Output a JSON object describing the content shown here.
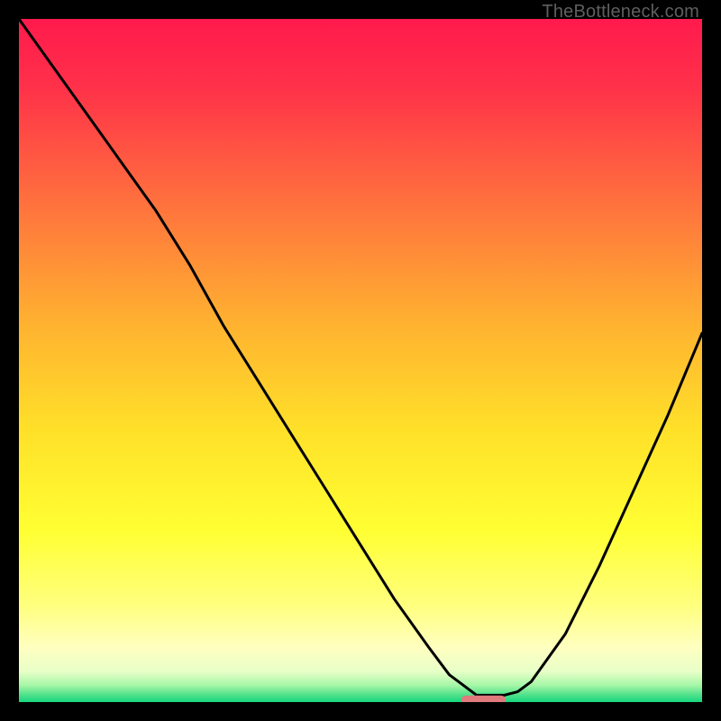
{
  "watermark": "TheBottleneck.com",
  "chart_data": {
    "type": "line",
    "title": "",
    "xlabel": "",
    "ylabel": "",
    "xlim": [
      0,
      100
    ],
    "ylim": [
      0,
      100
    ],
    "grid": false,
    "legend": false,
    "series": [
      {
        "name": "bottleneck-curve",
        "x": [
          0,
          5,
          10,
          15,
          20,
          25,
          30,
          35,
          40,
          45,
          50,
          55,
          60,
          63,
          67,
          71,
          73,
          75,
          80,
          85,
          90,
          95,
          100
        ],
        "values": [
          100,
          93,
          86,
          79,
          72,
          64,
          55,
          47,
          39,
          31,
          23,
          15,
          8,
          4,
          1,
          1,
          1.5,
          3,
          10,
          20,
          31,
          42,
          54
        ]
      }
    ],
    "marker": {
      "name": "optimal-point",
      "x_center": 68,
      "width": 6.5,
      "y": 0.3,
      "color": "#e07a7d"
    },
    "gradient_stops": [
      {
        "pos": 0.0,
        "color": "#ff1a4d"
      },
      {
        "pos": 0.1,
        "color": "#ff3149"
      },
      {
        "pos": 0.25,
        "color": "#ff6a3f"
      },
      {
        "pos": 0.45,
        "color": "#ffb330"
      },
      {
        "pos": 0.6,
        "color": "#ffe029"
      },
      {
        "pos": 0.75,
        "color": "#ffff33"
      },
      {
        "pos": 0.86,
        "color": "#ffff80"
      },
      {
        "pos": 0.92,
        "color": "#ffffc0"
      },
      {
        "pos": 0.955,
        "color": "#e8ffc8"
      },
      {
        "pos": 0.975,
        "color": "#a8f7a8"
      },
      {
        "pos": 0.99,
        "color": "#4de08a"
      },
      {
        "pos": 1.0,
        "color": "#15d67e"
      }
    ]
  }
}
